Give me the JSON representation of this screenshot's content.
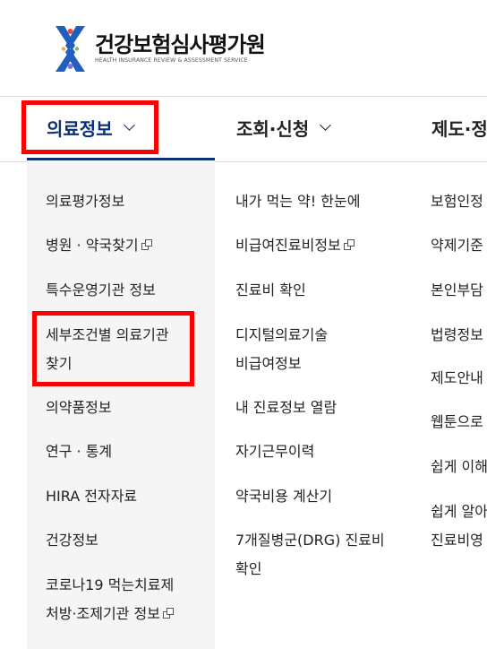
{
  "brand": {
    "name": "건강보험심사평가원",
    "subtitle": "HEALTH INSURANCE REVIEW & ASSESSMENT SERVICE"
  },
  "gnb": [
    {
      "label": "의료정보"
    },
    {
      "label": "조회·신청"
    },
    {
      "label": "제도·정"
    }
  ],
  "columns": {
    "col1": [
      {
        "label": "의료평가정보"
      },
      {
        "label": "병원 · 약국찾기"
      },
      {
        "label": "특수운영기관 정보"
      },
      {
        "label": "세부조건별 의료기관"
      },
      {
        "label": "찾기"
      },
      {
        "label": "의약품정보"
      },
      {
        "label": "연구 · 통계"
      },
      {
        "label": "HIRA 전자자료"
      },
      {
        "label": "건강정보"
      },
      {
        "label": "코로나19 먹는치료제"
      },
      {
        "label": "처방·조제기관 정보"
      }
    ],
    "col2": [
      {
        "label": "내가 먹는 약! 한눈에"
      },
      {
        "label": "비급여진료비정보"
      },
      {
        "label": "진료비 확인"
      },
      {
        "label": "디지털의료기술"
      },
      {
        "label": "비급여정보"
      },
      {
        "label": "내 진료정보 열람"
      },
      {
        "label": "자기근무이력"
      },
      {
        "label": "약국비용 계산기"
      },
      {
        "label": "7개질병군(DRG) 진료비"
      },
      {
        "label": "확인"
      }
    ],
    "col3": [
      {
        "label": "보험인정"
      },
      {
        "label": "약제기준"
      },
      {
        "label": "본인부담"
      },
      {
        "label": "법령정보"
      },
      {
        "label": "제도안내"
      },
      {
        "label": "웹툰으로"
      },
      {
        "label": "쉽게 이해"
      },
      {
        "label": "쉽게 알아"
      },
      {
        "label": "진료비영"
      }
    ]
  },
  "colors": {
    "accent": "#0b2f79",
    "highlight": "#ff0000"
  }
}
